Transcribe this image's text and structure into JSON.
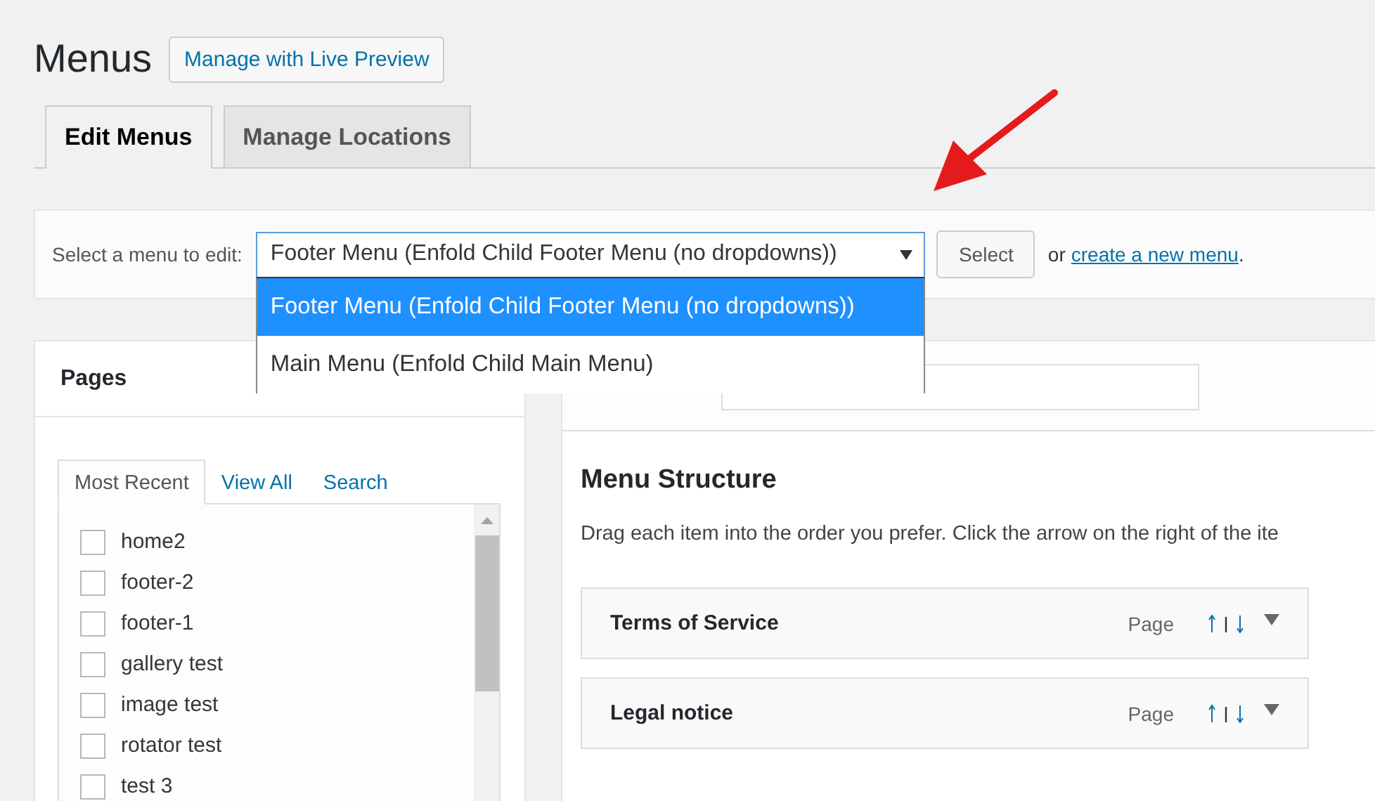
{
  "page_title": "Menus",
  "live_preview_button": "Manage with Live Preview",
  "tabs": [
    {
      "label": "Edit Menus",
      "selected": true
    },
    {
      "label": "Manage Locations",
      "selected": false
    }
  ],
  "menu_select": {
    "label": "Select a menu to edit:",
    "value": "Footer Menu (Enfold Child Footer Menu (no dropdowns))",
    "expanded": true,
    "options": [
      {
        "label": "Footer Menu (Enfold Child Footer Menu (no dropdowns))",
        "selected": true
      },
      {
        "label": "Main Menu (Enfold Child Main Menu)",
        "selected": false
      }
    ],
    "button": "Select",
    "or_text": "or",
    "create_link": "create a new menu",
    "period": "."
  },
  "pages_panel": {
    "title": "Pages",
    "tabs": [
      {
        "label": "Most Recent",
        "selected": true
      },
      {
        "label": "View All",
        "selected": false
      },
      {
        "label": "Search",
        "selected": false
      }
    ],
    "items": [
      {
        "label": "home2",
        "checked": false
      },
      {
        "label": "footer-2",
        "checked": false
      },
      {
        "label": "footer-1",
        "checked": false
      },
      {
        "label": "gallery test",
        "checked": false
      },
      {
        "label": "image test",
        "checked": false
      },
      {
        "label": "rotator test",
        "checked": false
      },
      {
        "label": "test 3",
        "checked": false
      }
    ]
  },
  "menu_structure": {
    "title": "Menu Structure",
    "instructions": "Drag each item into the order you prefer. Click the arrow on the right of the ite",
    "items": [
      {
        "title": "Terms of Service",
        "type": "Page"
      },
      {
        "title": "Legal notice",
        "type": "Page"
      }
    ]
  }
}
